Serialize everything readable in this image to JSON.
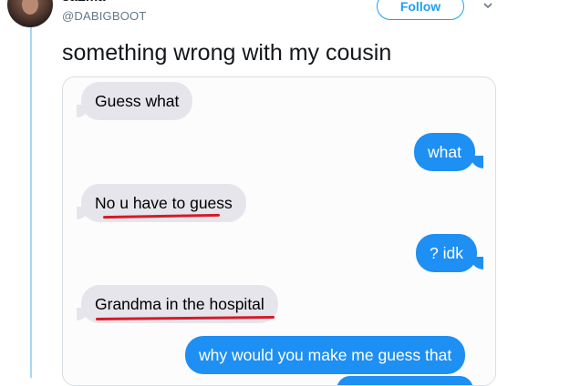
{
  "tweet": {
    "display_name": "saLma",
    "handle": "@DABIGBOOT",
    "follow_label": "Follow",
    "text": "something wrong with my cousin"
  },
  "messages": [
    {
      "direction": "incoming",
      "text": "Guess what"
    },
    {
      "direction": "outgoing",
      "text": "what"
    },
    {
      "direction": "incoming",
      "text": "No u have to guess",
      "underlined": true
    },
    {
      "direction": "outgoing",
      "text": "? idk"
    },
    {
      "direction": "incoming",
      "text": "Grandma in the hospital",
      "underlined": true
    },
    {
      "direction": "outgoing",
      "text": "why would you make me guess that"
    }
  ],
  "colors": {
    "accent": "#1da1f2",
    "incoming_bubble": "#e6e5eb",
    "outgoing_bubble": "#1e8ff3",
    "underline_mark": "#d61a2a"
  }
}
